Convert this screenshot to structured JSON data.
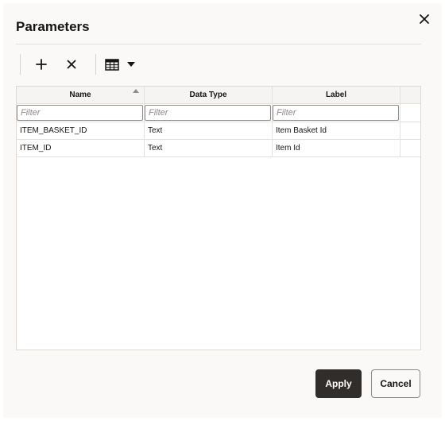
{
  "dialog": {
    "title": "Parameters",
    "close_icon": "close-icon"
  },
  "toolbar": {
    "add_icon": "plus-icon",
    "delete_icon": "x-icon",
    "view_icon": "table-grid-icon",
    "view_menu_icon": "caret-down-icon"
  },
  "grid": {
    "columns": [
      "Name",
      "Data Type",
      "Label"
    ],
    "sort": {
      "column": "Name",
      "direction": "ascending"
    },
    "filter_placeholders": [
      "Filter",
      "Filter",
      "Filter"
    ],
    "rows": [
      [
        "ITEM_BASKET_ID",
        "Text",
        "Item Basket Id"
      ],
      [
        "ITEM_ID",
        "Text",
        "Item Id"
      ]
    ]
  },
  "footer": {
    "apply_label": "Apply",
    "cancel_label": "Cancel"
  },
  "colors": {
    "dialog_bg": "#fbf9f8",
    "primary_button": "#312d2a",
    "text": "#161513"
  }
}
